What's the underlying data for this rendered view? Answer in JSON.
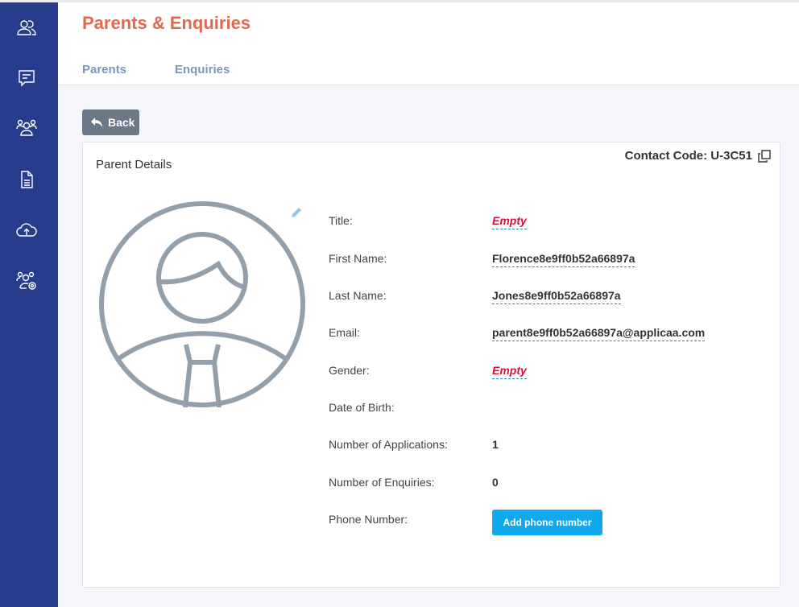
{
  "header": {
    "title": "Parents & Enquiries",
    "tabs": [
      {
        "label": "Parents"
      },
      {
        "label": "Enquiries"
      }
    ]
  },
  "sidebar": {
    "items": [
      {
        "icon": "contacts-icon"
      },
      {
        "icon": "message-icon"
      },
      {
        "icon": "group-icon"
      },
      {
        "icon": "document-icon"
      },
      {
        "icon": "cloud-upload-icon"
      },
      {
        "icon": "user-settings-icon"
      }
    ]
  },
  "toolbar": {
    "back_label": "Back"
  },
  "card": {
    "title": "Parent Details",
    "contact_code": "Contact Code: U-3C51",
    "fields": [
      {
        "label": "Title:",
        "value": "Empty"
      },
      {
        "label": "First Name:",
        "value": "Florence8e9ff0b52a66897a"
      },
      {
        "label": "Last Name:",
        "value": "Jones8e9ff0b52a66897a"
      },
      {
        "label": "Email:",
        "value": "parent8e9ff0b52a66897a@applicaa.com"
      },
      {
        "label": "Gender:",
        "value": "Empty"
      },
      {
        "label": "Date of Birth:",
        "value": ""
      },
      {
        "label": "Number of Applications:",
        "value": "1"
      },
      {
        "label": "Number of Enquiries:",
        "value": "0"
      },
      {
        "label": "Phone Number:",
        "value": ""
      }
    ],
    "add_phone_label": "Add phone number"
  },
  "colors": {
    "sidebar": "#283c8e",
    "title": "#e0694f",
    "tab": "#7b97b8",
    "empty": "#d0143c",
    "primary_button": "#10a9f0",
    "back_button": "#6b7887"
  }
}
